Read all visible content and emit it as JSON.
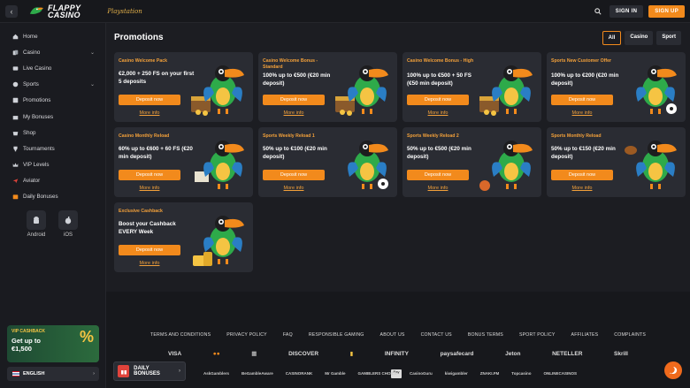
{
  "header": {
    "back_label": "‹",
    "logo_line1": "FLAPPY",
    "logo_line2": "CASINO",
    "partner_logo": "Playstation",
    "signin_label": "SIGN IN",
    "signup_label": "SIGN UP",
    "accent": "#f28a1c"
  },
  "sidebar": {
    "items": [
      {
        "label": "Home",
        "icon": "home-icon"
      },
      {
        "label": "Casino",
        "icon": "cards-icon",
        "chevron": "⌄"
      },
      {
        "label": "Live Casino",
        "icon": "live-icon"
      },
      {
        "label": "Sports",
        "icon": "ball-icon",
        "chevron": "⌄"
      },
      {
        "label": "Promotions",
        "icon": "promo-icon"
      },
      {
        "label": "My Bonuses",
        "icon": "bonus-icon"
      },
      {
        "label": "Shop",
        "icon": "shop-icon"
      },
      {
        "label": "Tournaments",
        "icon": "trophy-icon"
      },
      {
        "label": "VIP Levels",
        "icon": "vip-icon"
      },
      {
        "label": "Aviator",
        "icon": "plane-icon"
      },
      {
        "label": "Daily Bonuses",
        "icon": "calendar-icon"
      }
    ],
    "apps": [
      {
        "label": "Android",
        "icon": "android-icon"
      },
      {
        "label": "iOS",
        "icon": "apple-icon"
      }
    ],
    "vip": {
      "title": "VIP CASHBACK",
      "line1": "Get up to",
      "line2": "€1,500",
      "pct": "%"
    },
    "language": "ENGLISH"
  },
  "main": {
    "title": "Promotions",
    "filters": [
      "All",
      "Casino",
      "Sport"
    ],
    "cards": [
      {
        "cat": "Casino Welcome Pack",
        "text": "€2,000 + 250 FS on your first 5 deposits",
        "btn": "Deposit now",
        "more": "More info",
        "art": "toucan-chest"
      },
      {
        "cat": "Casino Welcome Bonus - Standard",
        "text": "100% up to €500 (€20 min deposit)",
        "btn": "Deposit now",
        "more": "More info",
        "art": "toucan-chest"
      },
      {
        "cat": "Casino Welcome Bonus - High",
        "text": "100% up to €500 + 50 FS (€50 min deposit)",
        "btn": "Deposit now",
        "more": "More info",
        "art": "toucan-chest"
      },
      {
        "cat": "Sports New Customer Offer",
        "text": "100% up to €200 (€20 min deposit)",
        "btn": "Deposit now",
        "more": "More info",
        "art": "toucan-football"
      },
      {
        "cat": "Casino Monthly Reload",
        "text": "60% up to €600 + 60 FS (€20 min deposit)",
        "btn": "Deposit now",
        "more": "More info",
        "art": "toucan-money"
      },
      {
        "cat": "Sports Weekly Reload 1",
        "text": "50% up to €100 (€20 min deposit)",
        "btn": "Deposit now",
        "more": "More info",
        "art": "toucan-ball"
      },
      {
        "cat": "Sports Weekly Reload 2",
        "text": "50% up to €500 (€20 min deposit)",
        "btn": "Deposit now",
        "more": "More info",
        "art": "toucan-basketball"
      },
      {
        "cat": "Sports Monthly Reload",
        "text": "50% up to €150 (€20 min deposit)",
        "btn": "Deposit now",
        "more": "More info",
        "art": "toucan-rugby"
      },
      {
        "cat": "Exclusive Cashback",
        "text": "Boost your Cashback EVERY Week",
        "btn": "Deposit now",
        "more": "More info",
        "art": "toucan-coins"
      }
    ]
  },
  "footer": {
    "links": [
      "TERMS AND CONDITIONS",
      "PRIVACY POLICY",
      "FAQ",
      "RESPONSIBLE GAMING",
      "ABOUT US",
      "CONTACT US",
      "BONUS TERMS",
      "SPORT POLICY",
      "AFFILIATES",
      "COMPLAINTS"
    ],
    "payments": [
      "VISA",
      "●●",
      "▦",
      "DISCOVER",
      "▮",
      "INFINITY",
      "paysafecard",
      "Jeton",
      "NETELLER",
      "Skrill"
    ],
    "paylogo": "Pay",
    "partners": [
      "AskGamblers",
      "BeGambleAware",
      "CASINORANK",
      "Mr Gamble",
      "GAMBLERS CHOICE",
      "CasinoGuru",
      "kiwigambler",
      "ZNAKI.FM",
      "Topcasino",
      "ONLINECASINOS"
    ]
  },
  "daily_bonus": {
    "label": "DAILY BONUSES",
    "chevron": "›"
  }
}
